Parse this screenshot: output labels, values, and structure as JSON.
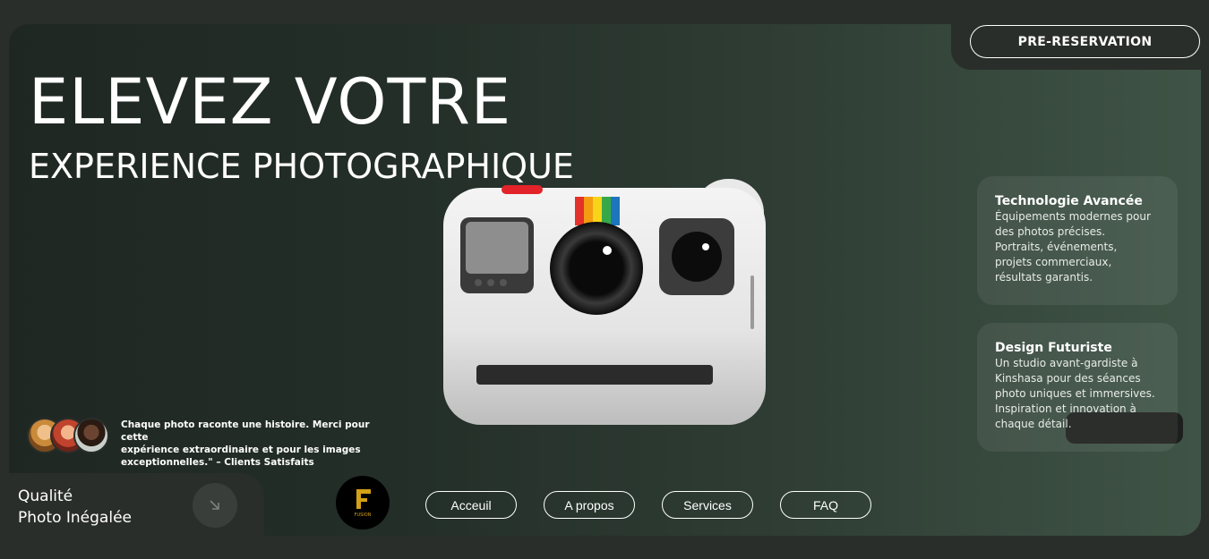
{
  "header": {
    "cta_label": "PRE-RESERVATION",
    "title_line1": "ELEVEZ VOTRE",
    "title_line2": "EXPERIENCE PHOTOGRAPHIQUE"
  },
  "features": [
    {
      "title": "Technologie Avancée",
      "lines": [
        "Équipements modernes pour",
        "des photos précises.",
        "Portraits, événements,",
        "projets commerciaux,",
        "résultats garantis."
      ]
    },
    {
      "title": "Design Futuriste",
      "lines": [
        "Un studio avant-gardiste à",
        "Kinshasa pour des séances",
        "photo uniques et immersives.",
        "Inspiration et innovation à",
        "chaque détail."
      ]
    }
  ],
  "testimonial": {
    "lines": [
      "Chaque photo raconte une histoire. Merci pour cette",
      "expérience extraordinaire et pour les images",
      "exceptionnelles.\" – Clients Satisfaits"
    ]
  },
  "quality": {
    "line1": "Qualité",
    "line2": "Photo Inégalée"
  },
  "logo": {
    "text": "FUSION"
  },
  "nav": {
    "items": [
      "Acceuil",
      "A propos",
      "Services",
      "FAQ"
    ]
  },
  "colors": {
    "background": "#2a2e2b",
    "hero_dark": "#1f2722",
    "hero_light": "#3f5446",
    "logo_gold": "#d4a017"
  },
  "icons": {
    "arrow": "arrow-down-right-icon",
    "camera": "instant-camera-image"
  }
}
